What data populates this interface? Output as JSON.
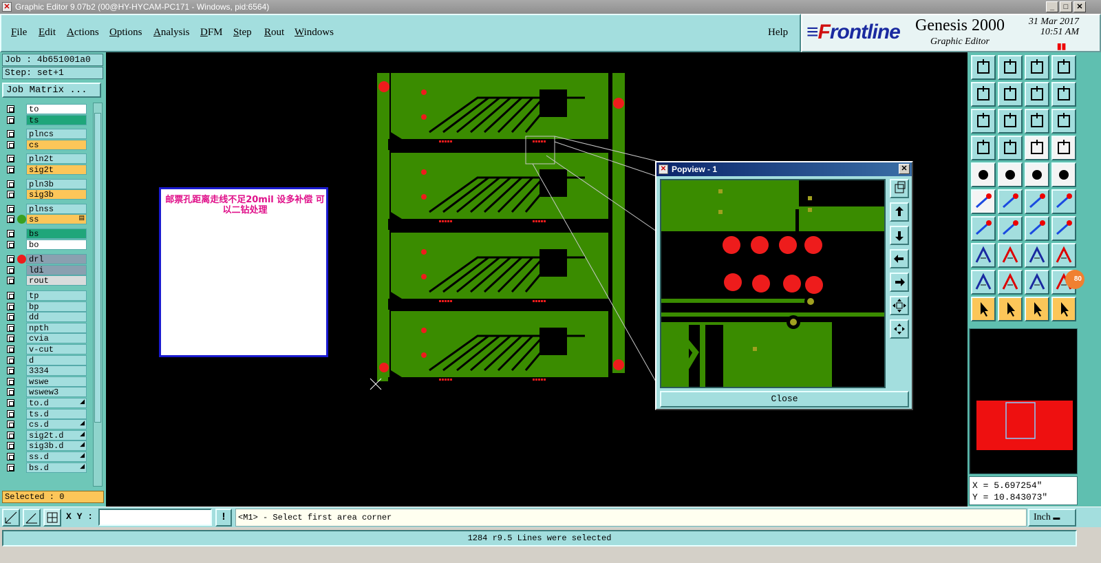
{
  "window": {
    "title": "Graphic Editor 9.07b2 (00@HY-HYCAM-PC171 - Windows, pid:6564)",
    "minimize_glyph": "_",
    "maximize_glyph": "□",
    "close_glyph": "✕"
  },
  "menu": [
    {
      "label": "File",
      "u": "F",
      "rest": "ile"
    },
    {
      "label": "Edit",
      "u": "E",
      "rest": "dit"
    },
    {
      "label": "Actions",
      "u": "A",
      "rest": "ctions"
    },
    {
      "label": "Options",
      "u": "O",
      "rest": "ptions"
    },
    {
      "label": "Analysis",
      "u": "A",
      "rest": "nalysis"
    },
    {
      "label": "DFM",
      "u": "D",
      "rest": "FM"
    },
    {
      "label": "Step",
      "u": "S",
      "rest": "tep"
    },
    {
      "label": "Rout",
      "u": "R",
      "rest": "out"
    },
    {
      "label": "Windows",
      "u": "W",
      "rest": "indows"
    },
    {
      "label": "Help",
      "u": "",
      "rest": "Help"
    }
  ],
  "brand": {
    "logo_f": "F",
    "logo_rest": "rontline",
    "product": "Genesis 2000",
    "subtitle": "Graphic Editor",
    "date": "31 Mar 2017",
    "time": "10:51 AM",
    "indicator": "▮▮"
  },
  "job": {
    "job_label": "Job : 4b651001a0",
    "step_label": "Step: set+1",
    "job_matrix_button": "Job Matrix ..."
  },
  "layers": [
    {
      "name": "to",
      "color": "#ffffff",
      "dot": ""
    },
    {
      "name": "ts",
      "color": "#1fa67a",
      "dot": ""
    },
    {
      "name": "plncs",
      "color": "#a3dede",
      "dot": ""
    },
    {
      "name": "cs",
      "color": "#fcc659",
      "dot": ""
    },
    {
      "name": "pln2t",
      "color": "#a3dede",
      "dot": ""
    },
    {
      "name": "sig2t",
      "color": "#fcc659",
      "dot": ""
    },
    {
      "name": "pln3b",
      "color": "#a3dede",
      "dot": ""
    },
    {
      "name": "sig3b",
      "color": "#fcc659",
      "dot": ""
    },
    {
      "name": "plnss",
      "color": "#a3dede",
      "dot": ""
    },
    {
      "name": "ss",
      "color": "#fcc659",
      "dot": "#3aa020",
      "arrow": "▤"
    },
    {
      "name": "bs",
      "color": "#1fa67a",
      "dot": ""
    },
    {
      "name": "bo",
      "color": "#ffffff",
      "dot": ""
    },
    {
      "name": "drl",
      "color": "#8aa0b0",
      "dot": "#ee1c1c"
    },
    {
      "name": "ldi",
      "color": "#8aa0b0",
      "dot": ""
    },
    {
      "name": "rout",
      "color": "#d8dcdc",
      "dot": ""
    },
    {
      "name": "tp",
      "color": "#a3dede",
      "dot": ""
    },
    {
      "name": "bp",
      "color": "#a3dede",
      "dot": ""
    },
    {
      "name": "dd",
      "color": "#a3dede",
      "dot": ""
    },
    {
      "name": "npth",
      "color": "#a3dede",
      "dot": ""
    },
    {
      "name": "cvia",
      "color": "#a3dede",
      "dot": ""
    },
    {
      "name": "v-cut",
      "color": "#a3dede",
      "dot": ""
    },
    {
      "name": "d",
      "color": "#a3dede",
      "dot": ""
    },
    {
      "name": "3334",
      "color": "#a3dede",
      "dot": ""
    },
    {
      "name": "wswe",
      "color": "#a3dede",
      "dot": ""
    },
    {
      "name": "wswew3",
      "color": "#a3dede",
      "dot": ""
    },
    {
      "name": "to.d",
      "color": "#a3dede",
      "dot": "",
      "arrow": "◢"
    },
    {
      "name": "ts.d",
      "color": "#a3dede",
      "dot": ""
    },
    {
      "name": "cs.d",
      "color": "#a3dede",
      "dot": "",
      "arrow": "◢"
    },
    {
      "name": "sig2t.d",
      "color": "#a3dede",
      "dot": "",
      "arrow": "◢"
    },
    {
      "name": "sig3b.d",
      "color": "#a3dede",
      "dot": "",
      "arrow": "◢"
    },
    {
      "name": "ss.d",
      "color": "#a3dede",
      "dot": "",
      "arrow": "◢"
    },
    {
      "name": "bs.d",
      "color": "#a3dede",
      "dot": "",
      "arrow": "◢"
    }
  ],
  "selected_label": "Selected : 0",
  "note": {
    "text": "邮票孔距离走线不足20mil  设多补偿    可以二钻处理"
  },
  "popview": {
    "title": "Popview - 1",
    "close_button": "Close"
  },
  "coords": {
    "x": "X = 5.697254\"",
    "y": "Y = 10.843073\""
  },
  "bottom": {
    "xy_label": "X Y :",
    "xy_value": "",
    "bang": "!",
    "prompt": "<M1> - Select first area corner",
    "units": "Inch"
  },
  "status": "1284 r9.5 Lines were selected",
  "badge": "80",
  "colors": {
    "board_green": "#3a8c00",
    "pad_red": "#ee1c1c",
    "panel_teal": "#a3dede"
  }
}
